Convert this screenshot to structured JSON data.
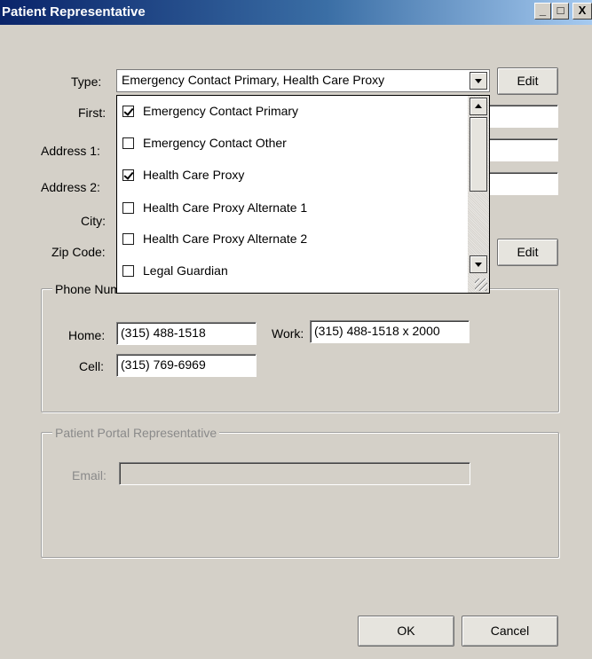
{
  "window": {
    "title": "Patient Representative",
    "controls": {
      "minimize": "_",
      "maximize": "□",
      "close": "X"
    }
  },
  "form": {
    "type_label": "Type:",
    "type_value": "Emergency Contact Primary, Health Care Proxy",
    "edit_label": "Edit",
    "first_label": "First:",
    "address1_label": "Address 1:",
    "address2_label": "Address 2:",
    "city_label": "City:",
    "zip_label": "Zip Code:",
    "zip_edit_label": "Edit"
  },
  "type_dropdown": {
    "items": [
      {
        "label": "Emergency Contact Primary",
        "checked": true
      },
      {
        "label": "Emergency Contact Other",
        "checked": false
      },
      {
        "label": "Health Care Proxy",
        "checked": true
      },
      {
        "label": "Health Care Proxy Alternate 1",
        "checked": false
      },
      {
        "label": "Health Care Proxy Alternate 2",
        "checked": false
      },
      {
        "label": "Legal Guardian",
        "checked": false
      }
    ]
  },
  "phone": {
    "group_title": "Phone Numbers",
    "home_label": "Home:",
    "home_value": "(315) 488-1518",
    "work_label": "Work:",
    "work_value": "(315) 488-1518 x 2000",
    "cell_label": "Cell:",
    "cell_value": "(315) 769-6969"
  },
  "portal": {
    "group_title": "Patient Portal Representative",
    "email_label": "Email:",
    "email_value": ""
  },
  "footer": {
    "ok_label": "OK",
    "cancel_label": "Cancel"
  }
}
